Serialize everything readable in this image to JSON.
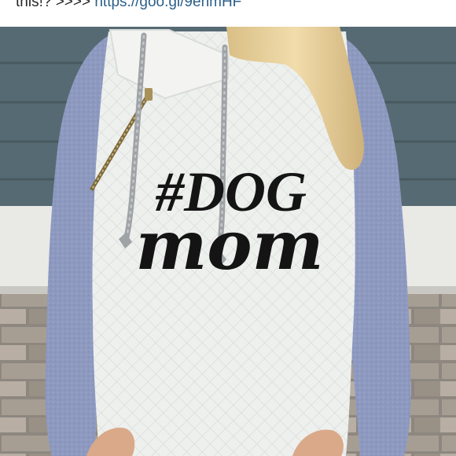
{
  "caption": {
    "text": "this!? >>>> ",
    "link": "https://goo.gl/9enmHF"
  },
  "product_photo": {
    "print_line1": "#DOG",
    "print_line2": "mom"
  },
  "colors": {
    "link": "#2b5f8a",
    "caption_text": "#262626",
    "hoodie_body": "#eef0ee",
    "hoodie_sleeve": "#8e99c0",
    "hair": "#e7cf97",
    "print": "#141414",
    "siding": "#566a73",
    "brick": "#a79e93"
  },
  "icons": {
    "drawstring": "drawstring-icon",
    "zipper": "zipper-icon"
  }
}
